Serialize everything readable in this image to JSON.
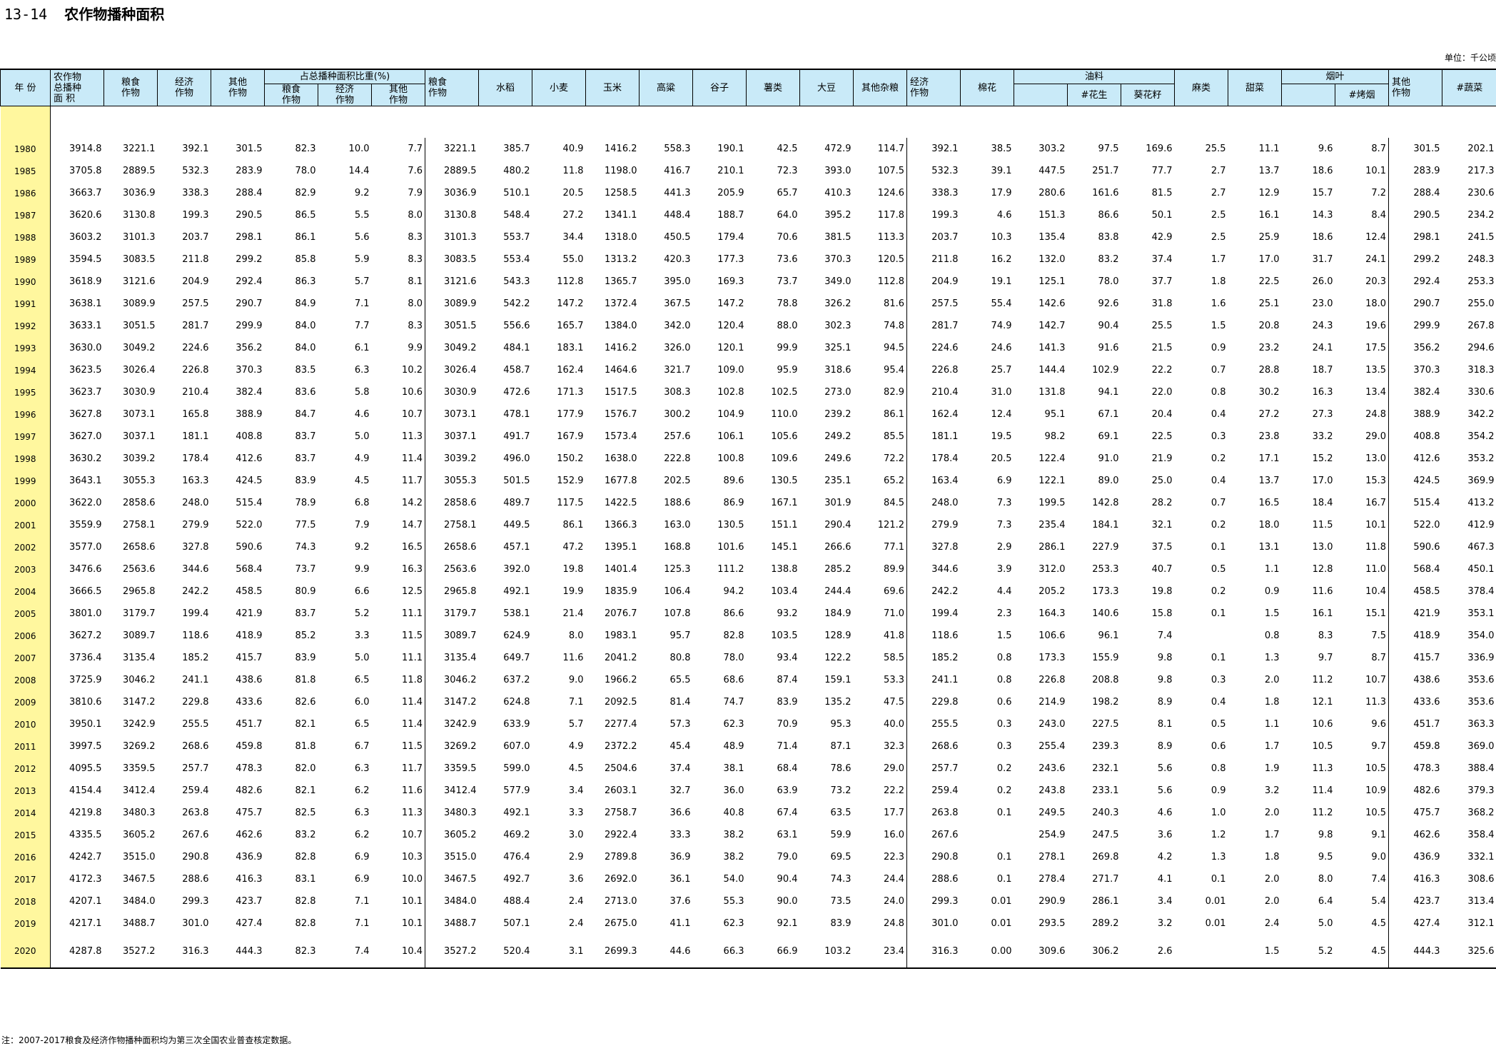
{
  "title": {
    "code": "13-14",
    "text": "农作物播种面积"
  },
  "unit_label": "单位：千公顷",
  "note": "注：2007-2017粮食及经济作物播种面积均为第三次全国农业普查核定数据。",
  "headers": {
    "year": "年  份",
    "total": [
      "农作物",
      "总播种",
      "面  积"
    ],
    "group_share": "占总播种面积比重(%)",
    "grain": [
      "粮食",
      "作物"
    ],
    "economic": [
      "经济",
      "作物"
    ],
    "other": [
      "其他",
      "作物"
    ],
    "rice": "水稻",
    "wheat": "小麦",
    "corn": "玉米",
    "sorghum": "高粱",
    "millet": "谷子",
    "tubers": "薯类",
    "soybean": "大豆",
    "other_grain": "其他杂粮",
    "cotton": "棉花",
    "oilseed": "油料",
    "peanut": "#花生",
    "sunflower": "葵花籽",
    "hemp": "麻类",
    "beet": "甜菜",
    "tobacco": "烟叶",
    "flue_cured": "#烤烟",
    "vegetable": "#蔬菜"
  },
  "rows": [
    [
      "1980",
      "3914.8",
      "3221.1",
      "392.1",
      "301.5",
      "82.3",
      "10.0",
      "7.7",
      "3221.1",
      "385.7",
      "40.9",
      "1416.2",
      "558.3",
      "190.1",
      "42.5",
      "472.9",
      "114.7",
      "392.1",
      "38.5",
      "303.2",
      "97.5",
      "169.6",
      "25.5",
      "11.1",
      "9.6",
      "8.7",
      "301.5",
      "202.1"
    ],
    [
      "1985",
      "3705.8",
      "2889.5",
      "532.3",
      "283.9",
      "78.0",
      "14.4",
      "7.6",
      "2889.5",
      "480.2",
      "11.8",
      "1198.0",
      "416.7",
      "210.1",
      "72.3",
      "393.0",
      "107.5",
      "532.3",
      "39.1",
      "447.5",
      "251.7",
      "77.7",
      "2.7",
      "13.7",
      "18.6",
      "10.1",
      "283.9",
      "217.3"
    ],
    [
      "1986",
      "3663.7",
      "3036.9",
      "338.3",
      "288.4",
      "82.9",
      "9.2",
      "7.9",
      "3036.9",
      "510.1",
      "20.5",
      "1258.5",
      "441.3",
      "205.9",
      "65.7",
      "410.3",
      "124.6",
      "338.3",
      "17.9",
      "280.6",
      "161.6",
      "81.5",
      "2.7",
      "12.9",
      "15.7",
      "7.2",
      "288.4",
      "230.6"
    ],
    [
      "1987",
      "3620.6",
      "3130.8",
      "199.3",
      "290.5",
      "86.5",
      "5.5",
      "8.0",
      "3130.8",
      "548.4",
      "27.2",
      "1341.1",
      "448.4",
      "188.7",
      "64.0",
      "395.2",
      "117.8",
      "199.3",
      "4.6",
      "151.3",
      "86.6",
      "50.1",
      "2.5",
      "16.1",
      "14.3",
      "8.4",
      "290.5",
      "234.2"
    ],
    [
      "1988",
      "3603.2",
      "3101.3",
      "203.7",
      "298.1",
      "86.1",
      "5.6",
      "8.3",
      "3101.3",
      "553.7",
      "34.4",
      "1318.0",
      "450.5",
      "179.4",
      "70.6",
      "381.5",
      "113.3",
      "203.7",
      "10.3",
      "135.4",
      "83.8",
      "42.9",
      "2.5",
      "25.9",
      "18.6",
      "12.4",
      "298.1",
      "241.5"
    ],
    [
      "1989",
      "3594.5",
      "3083.5",
      "211.8",
      "299.2",
      "85.8",
      "5.9",
      "8.3",
      "3083.5",
      "553.4",
      "55.0",
      "1313.2",
      "420.3",
      "177.3",
      "73.6",
      "370.3",
      "120.5",
      "211.8",
      "16.2",
      "132.0",
      "83.2",
      "37.4",
      "1.7",
      "17.0",
      "31.7",
      "24.1",
      "299.2",
      "248.3"
    ],
    [
      "1990",
      "3618.9",
      "3121.6",
      "204.9",
      "292.4",
      "86.3",
      "5.7",
      "8.1",
      "3121.6",
      "543.3",
      "112.8",
      "1365.7",
      "395.0",
      "169.3",
      "73.7",
      "349.0",
      "112.8",
      "204.9",
      "19.1",
      "125.1",
      "78.0",
      "37.7",
      "1.8",
      "22.5",
      "26.0",
      "20.3",
      "292.4",
      "253.3"
    ],
    [
      "1991",
      "3638.1",
      "3089.9",
      "257.5",
      "290.7",
      "84.9",
      "7.1",
      "8.0",
      "3089.9",
      "542.2",
      "147.2",
      "1372.4",
      "367.5",
      "147.2",
      "78.8",
      "326.2",
      "81.6",
      "257.5",
      "55.4",
      "142.6",
      "92.6",
      "31.8",
      "1.6",
      "25.1",
      "23.0",
      "18.0",
      "290.7",
      "255.0"
    ],
    [
      "1992",
      "3633.1",
      "3051.5",
      "281.7",
      "299.9",
      "84.0",
      "7.7",
      "8.3",
      "3051.5",
      "556.6",
      "165.7",
      "1384.0",
      "342.0",
      "120.4",
      "88.0",
      "302.3",
      "74.8",
      "281.7",
      "74.9",
      "142.7",
      "90.4",
      "25.5",
      "1.5",
      "20.8",
      "24.3",
      "19.6",
      "299.9",
      "267.8"
    ],
    [
      "1993",
      "3630.0",
      "3049.2",
      "224.6",
      "356.2",
      "84.0",
      "6.1",
      "9.9",
      "3049.2",
      "484.1",
      "183.1",
      "1416.2",
      "326.0",
      "120.1",
      "99.9",
      "325.1",
      "94.5",
      "224.6",
      "24.6",
      "141.3",
      "91.6",
      "21.5",
      "0.9",
      "23.2",
      "24.1",
      "17.5",
      "356.2",
      "294.6"
    ],
    [
      "1994",
      "3623.5",
      "3026.4",
      "226.8",
      "370.3",
      "83.5",
      "6.3",
      "10.2",
      "3026.4",
      "458.7",
      "162.4",
      "1464.6",
      "321.7",
      "109.0",
      "95.9",
      "318.6",
      "95.4",
      "226.8",
      "25.7",
      "144.4",
      "102.9",
      "22.2",
      "0.7",
      "28.8",
      "18.7",
      "13.5",
      "370.3",
      "318.3"
    ],
    [
      "1995",
      "3623.7",
      "3030.9",
      "210.4",
      "382.4",
      "83.6",
      "5.8",
      "10.6",
      "3030.9",
      "472.6",
      "171.3",
      "1517.5",
      "308.3",
      "102.8",
      "102.5",
      "273.0",
      "82.9",
      "210.4",
      "31.0",
      "131.8",
      "94.1",
      "22.0",
      "0.8",
      "30.2",
      "16.3",
      "13.4",
      "382.4",
      "330.6"
    ],
    [
      "1996",
      "3627.8",
      "3073.1",
      "165.8",
      "388.9",
      "84.7",
      "4.6",
      "10.7",
      "3073.1",
      "478.1",
      "177.9",
      "1576.7",
      "300.2",
      "104.9",
      "110.0",
      "239.2",
      "86.1",
      "162.4",
      "12.4",
      "95.1",
      "67.1",
      "20.4",
      "0.4",
      "27.2",
      "27.3",
      "24.8",
      "388.9",
      "342.2"
    ],
    [
      "1997",
      "3627.0",
      "3037.1",
      "181.1",
      "408.8",
      "83.7",
      "5.0",
      "11.3",
      "3037.1",
      "491.7",
      "167.9",
      "1573.4",
      "257.6",
      "106.1",
      "105.6",
      "249.2",
      "85.5",
      "181.1",
      "19.5",
      "98.2",
      "69.1",
      "22.5",
      "0.3",
      "23.8",
      "33.2",
      "29.0",
      "408.8",
      "354.2"
    ],
    [
      "1998",
      "3630.2",
      "3039.2",
      "178.4",
      "412.6",
      "83.7",
      "4.9",
      "11.4",
      "3039.2",
      "496.0",
      "150.2",
      "1638.0",
      "222.8",
      "100.8",
      "109.6",
      "249.6",
      "72.2",
      "178.4",
      "20.5",
      "122.4",
      "91.0",
      "21.9",
      "0.2",
      "17.1",
      "15.2",
      "13.0",
      "412.6",
      "353.2"
    ],
    [
      "1999",
      "3643.1",
      "3055.3",
      "163.3",
      "424.5",
      "83.9",
      "4.5",
      "11.7",
      "3055.3",
      "501.5",
      "152.9",
      "1677.8",
      "202.5",
      "89.6",
      "130.5",
      "235.1",
      "65.2",
      "163.4",
      "6.9",
      "122.1",
      "89.0",
      "25.0",
      "0.4",
      "13.7",
      "17.0",
      "15.3",
      "424.5",
      "369.9"
    ],
    [
      "2000",
      "3622.0",
      "2858.6",
      "248.0",
      "515.4",
      "78.9",
      "6.8",
      "14.2",
      "2858.6",
      "489.7",
      "117.5",
      "1422.5",
      "188.6",
      "86.9",
      "167.1",
      "301.9",
      "84.5",
      "248.0",
      "7.3",
      "199.5",
      "142.8",
      "28.2",
      "0.7",
      "16.5",
      "18.4",
      "16.7",
      "515.4",
      "413.2"
    ],
    [
      "2001",
      "3559.9",
      "2758.1",
      "279.9",
      "522.0",
      "77.5",
      "7.9",
      "14.7",
      "2758.1",
      "449.5",
      "86.1",
      "1366.3",
      "163.0",
      "130.5",
      "151.1",
      "290.4",
      "121.2",
      "279.9",
      "7.3",
      "235.4",
      "184.1",
      "32.1",
      "0.2",
      "18.0",
      "11.5",
      "10.1",
      "522.0",
      "412.9"
    ],
    [
      "2002",
      "3577.0",
      "2658.6",
      "327.8",
      "590.6",
      "74.3",
      "9.2",
      "16.5",
      "2658.6",
      "457.1",
      "47.2",
      "1395.1",
      "168.8",
      "101.6",
      "145.1",
      "266.6",
      "77.1",
      "327.8",
      "2.9",
      "286.1",
      "227.9",
      "37.5",
      "0.1",
      "13.1",
      "13.0",
      "11.8",
      "590.6",
      "467.3"
    ],
    [
      "2003",
      "3476.6",
      "2563.6",
      "344.6",
      "568.4",
      "73.7",
      "9.9",
      "16.3",
      "2563.6",
      "392.0",
      "19.8",
      "1401.4",
      "125.3",
      "111.2",
      "138.8",
      "285.2",
      "89.9",
      "344.6",
      "3.9",
      "312.0",
      "253.3",
      "40.7",
      "0.5",
      "1.1",
      "12.8",
      "11.0",
      "568.4",
      "450.1"
    ],
    [
      "2004",
      "3666.5",
      "2965.8",
      "242.2",
      "458.5",
      "80.9",
      "6.6",
      "12.5",
      "2965.8",
      "492.1",
      "19.9",
      "1835.9",
      "106.4",
      "94.2",
      "103.4",
      "244.4",
      "69.6",
      "242.2",
      "4.4",
      "205.2",
      "173.3",
      "19.8",
      "0.2",
      "0.9",
      "11.6",
      "10.4",
      "458.5",
      "378.4"
    ],
    [
      "2005",
      "3801.0",
      "3179.7",
      "199.4",
      "421.9",
      "83.7",
      "5.2",
      "11.1",
      "3179.7",
      "538.1",
      "21.4",
      "2076.7",
      "107.8",
      "86.6",
      "93.2",
      "184.9",
      "71.0",
      "199.4",
      "2.3",
      "164.3",
      "140.6",
      "15.8",
      "0.1",
      "1.5",
      "16.1",
      "15.1",
      "421.9",
      "353.1"
    ],
    [
      "2006",
      "3627.2",
      "3089.7",
      "118.6",
      "418.9",
      "85.2",
      "3.3",
      "11.5",
      "3089.7",
      "624.9",
      "8.0",
      "1983.1",
      "95.7",
      "82.8",
      "103.5",
      "128.9",
      "41.8",
      "118.6",
      "1.5",
      "106.6",
      "96.1",
      "7.4",
      "",
      "0.8",
      "8.3",
      "7.5",
      "418.9",
      "354.0"
    ],
    [
      "2007",
      "3736.4",
      "3135.4",
      "185.2",
      "415.7",
      "83.9",
      "5.0",
      "11.1",
      "3135.4",
      "649.7",
      "11.6",
      "2041.2",
      "80.8",
      "78.0",
      "93.4",
      "122.2",
      "58.5",
      "185.2",
      "0.8",
      "173.3",
      "155.9",
      "9.8",
      "0.1",
      "1.3",
      "9.7",
      "8.7",
      "415.7",
      "336.9"
    ],
    [
      "2008",
      "3725.9",
      "3046.2",
      "241.1",
      "438.6",
      "81.8",
      "6.5",
      "11.8",
      "3046.2",
      "637.2",
      "9.0",
      "1966.2",
      "65.5",
      "68.6",
      "87.4",
      "159.1",
      "53.3",
      "241.1",
      "0.8",
      "226.8",
      "208.8",
      "9.8",
      "0.3",
      "2.0",
      "11.2",
      "10.7",
      "438.6",
      "353.6"
    ],
    [
      "2009",
      "3810.6",
      "3147.2",
      "229.8",
      "433.6",
      "82.6",
      "6.0",
      "11.4",
      "3147.2",
      "624.8",
      "7.1",
      "2092.5",
      "81.4",
      "74.7",
      "83.9",
      "135.2",
      "47.5",
      "229.8",
      "0.6",
      "214.9",
      "198.2",
      "8.9",
      "0.4",
      "1.8",
      "12.1",
      "11.3",
      "433.6",
      "353.6"
    ],
    [
      "2010",
      "3950.1",
      "3242.9",
      "255.5",
      "451.7",
      "82.1",
      "6.5",
      "11.4",
      "3242.9",
      "633.9",
      "5.7",
      "2277.4",
      "57.3",
      "62.3",
      "70.9",
      "95.3",
      "40.0",
      "255.5",
      "0.3",
      "243.0",
      "227.5",
      "8.1",
      "0.5",
      "1.1",
      "10.6",
      "9.6",
      "451.7",
      "363.3"
    ],
    [
      "2011",
      "3997.5",
      "3269.2",
      "268.6",
      "459.8",
      "81.8",
      "6.7",
      "11.5",
      "3269.2",
      "607.0",
      "4.9",
      "2372.2",
      "45.4",
      "48.9",
      "71.4",
      "87.1",
      "32.3",
      "268.6",
      "0.3",
      "255.4",
      "239.3",
      "8.9",
      "0.6",
      "1.7",
      "10.5",
      "9.7",
      "459.8",
      "369.0"
    ],
    [
      "2012",
      "4095.5",
      "3359.5",
      "257.7",
      "478.3",
      "82.0",
      "6.3",
      "11.7",
      "3359.5",
      "599.0",
      "4.5",
      "2504.6",
      "37.4",
      "38.1",
      "68.4",
      "78.6",
      "29.0",
      "257.7",
      "0.2",
      "243.6",
      "232.1",
      "5.6",
      "0.8",
      "1.9",
      "11.3",
      "10.5",
      "478.3",
      "388.4"
    ],
    [
      "2013",
      "4154.4",
      "3412.4",
      "259.4",
      "482.6",
      "82.1",
      "6.2",
      "11.6",
      "3412.4",
      "577.9",
      "3.4",
      "2603.1",
      "32.7",
      "36.0",
      "63.9",
      "73.2",
      "22.2",
      "259.4",
      "0.2",
      "243.8",
      "233.1",
      "5.6",
      "0.9",
      "3.2",
      "11.4",
      "10.9",
      "482.6",
      "379.3"
    ],
    [
      "2014",
      "4219.8",
      "3480.3",
      "263.8",
      "475.7",
      "82.5",
      "6.3",
      "11.3",
      "3480.3",
      "492.1",
      "3.3",
      "2758.7",
      "36.6",
      "40.8",
      "67.4",
      "63.5",
      "17.7",
      "263.8",
      "0.1",
      "249.5",
      "240.3",
      "4.6",
      "1.0",
      "2.0",
      "11.2",
      "10.5",
      "475.7",
      "368.2"
    ],
    [
      "2015",
      "4335.5",
      "3605.2",
      "267.6",
      "462.6",
      "83.2",
      "6.2",
      "10.7",
      "3605.2",
      "469.2",
      "3.0",
      "2922.4",
      "33.3",
      "38.2",
      "63.1",
      "59.9",
      "16.0",
      "267.6",
      "",
      "254.9",
      "247.5",
      "3.6",
      "1.2",
      "1.7",
      "9.8",
      "9.1",
      "462.6",
      "358.4"
    ],
    [
      "2016",
      "4242.7",
      "3515.0",
      "290.8",
      "436.9",
      "82.8",
      "6.9",
      "10.3",
      "3515.0",
      "476.4",
      "2.9",
      "2789.8",
      "36.9",
      "38.2",
      "79.0",
      "69.5",
      "22.3",
      "290.8",
      "0.1",
      "278.1",
      "269.8",
      "4.2",
      "1.3",
      "1.8",
      "9.5",
      "9.0",
      "436.9",
      "332.1"
    ],
    [
      "2017",
      "4172.3",
      "3467.5",
      "288.6",
      "416.3",
      "83.1",
      "6.9",
      "10.0",
      "3467.5",
      "492.7",
      "3.6",
      "2692.0",
      "36.1",
      "54.0",
      "90.4",
      "74.3",
      "24.4",
      "288.6",
      "0.1",
      "278.4",
      "271.7",
      "4.1",
      "0.1",
      "2.0",
      "8.0",
      "7.4",
      "416.3",
      "308.6"
    ],
    [
      "2018",
      "4207.1",
      "3484.0",
      "299.3",
      "423.7",
      "82.8",
      "7.1",
      "10.1",
      "3484.0",
      "488.4",
      "2.4",
      "2713.0",
      "37.6",
      "55.3",
      "90.0",
      "73.5",
      "24.0",
      "299.3",
      "0.01",
      "290.9",
      "286.1",
      "3.4",
      "0.01",
      "2.0",
      "6.4",
      "5.4",
      "423.7",
      "313.4"
    ],
    [
      "2019",
      "4217.1",
      "3488.7",
      "301.0",
      "427.4",
      "82.8",
      "7.1",
      "10.1",
      "3488.7",
      "507.1",
      "2.4",
      "2675.0",
      "41.1",
      "62.3",
      "92.1",
      "83.9",
      "24.8",
      "301.0",
      "0.01",
      "293.5",
      "289.2",
      "3.2",
      "0.01",
      "2.4",
      "5.0",
      "4.5",
      "427.4",
      "312.1"
    ],
    [
      "2020",
      "4287.8",
      "3527.2",
      "316.3",
      "444.3",
      "82.3",
      "7.4",
      "10.4",
      "3527.2",
      "520.4",
      "3.1",
      "2699.3",
      "44.6",
      "66.3",
      "66.9",
      "103.2",
      "23.4",
      "316.3",
      "0.00",
      "309.6",
      "306.2",
      "2.6",
      "",
      "1.5",
      "5.2",
      "4.5",
      "444.3",
      "325.6"
    ]
  ]
}
